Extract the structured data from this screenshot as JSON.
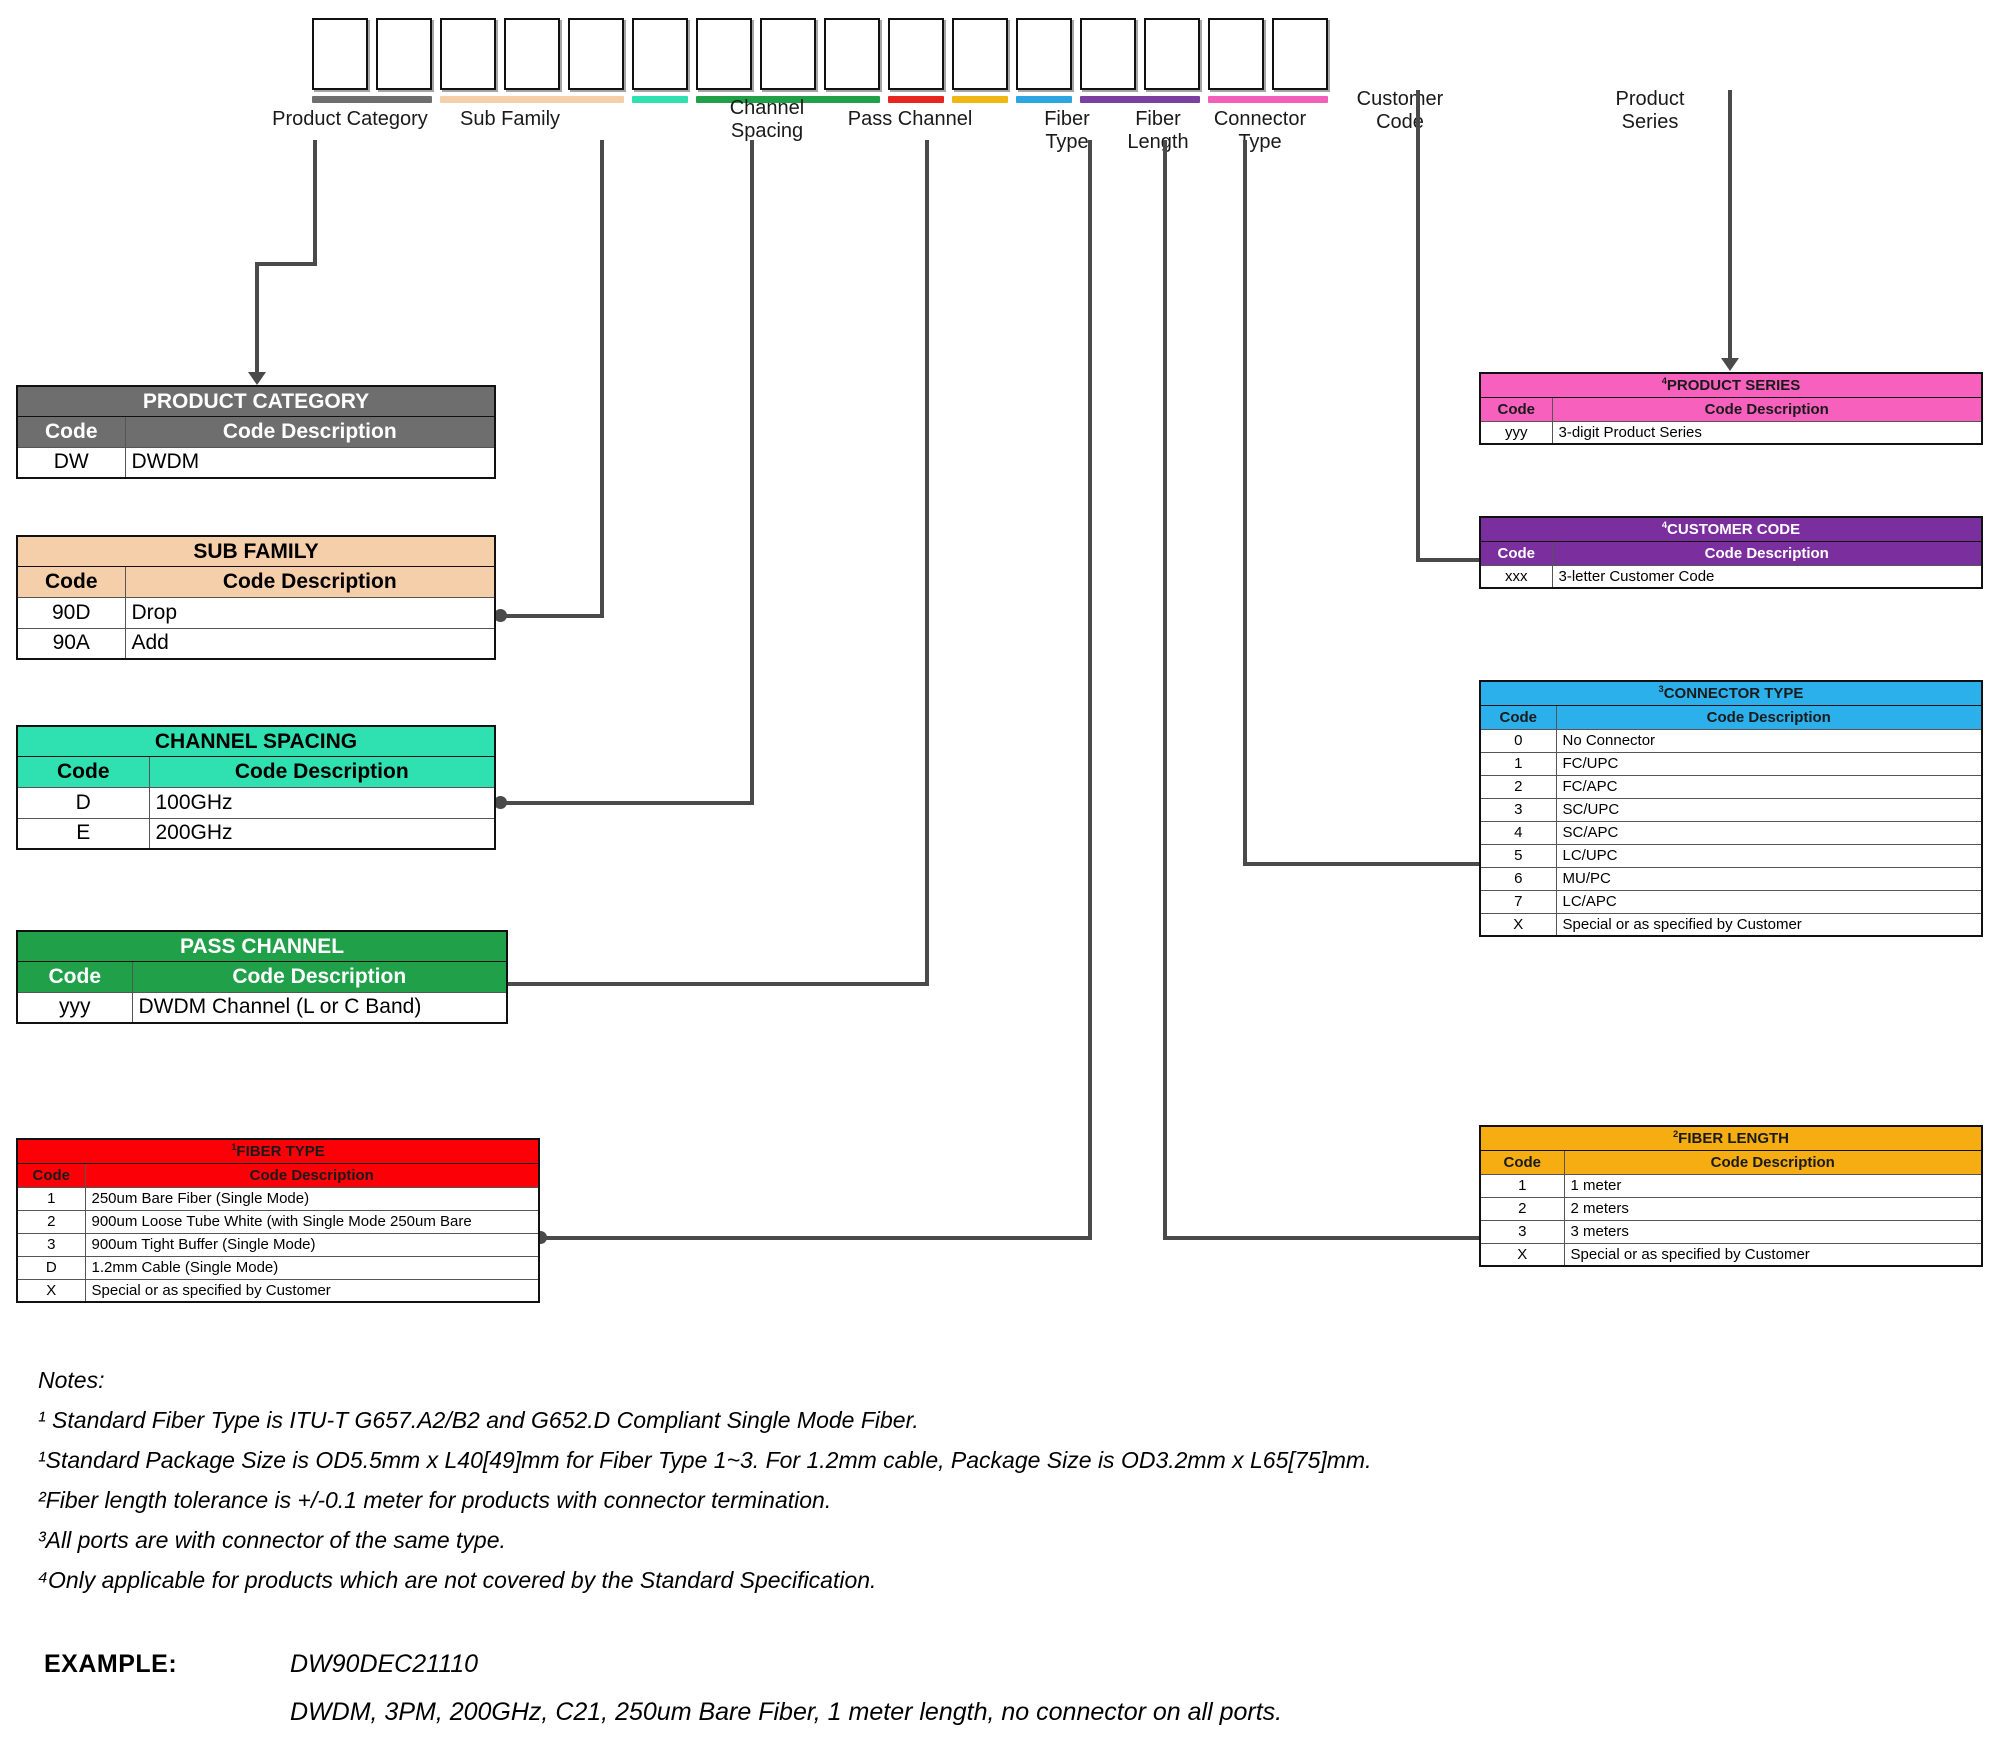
{
  "diagram": {
    "title": "DWDM Part Number Structure",
    "code_box_count": 16,
    "groups": [
      {
        "id": "product-category",
        "label": "Product Category",
        "color": "#6e6e6e",
        "boxes": 2
      },
      {
        "id": "sub-family",
        "label": "Sub Family",
        "color": "#f5ceaa",
        "boxes": 3
      },
      {
        "id": "channel-spacing",
        "label": "Channel\nSpacing",
        "color": "#2fe0b0",
        "boxes": 1
      },
      {
        "id": "pass-channel",
        "label": "Pass Channel",
        "color": "#21a04a",
        "boxes": 3
      },
      {
        "id": "fiber-type",
        "label": "Fiber\nType",
        "color": "#e8251f",
        "boxes": 1
      },
      {
        "id": "fiber-length",
        "label": "Fiber\nLength",
        "color": "#efb713",
        "boxes": 1
      },
      {
        "id": "connector-type",
        "label": "Connector\nType",
        "color": "#2ba6e0",
        "boxes": 1
      },
      {
        "id": "customer-code",
        "label": "Customer\nCode",
        "color": "#7b3fa0",
        "boxes": 2
      },
      {
        "id": "product-series",
        "label": "Product\nSeries",
        "color": "#f25fba",
        "boxes": 2
      }
    ]
  },
  "tables": {
    "product_category": {
      "title": "PRODUCT CATEGORY",
      "superscript": "",
      "header_color": "#6e6e6e",
      "title_text_color": "#ffffff",
      "header_text_color": "#ffffff",
      "columns": [
        "Code",
        "Code Description"
      ],
      "rows": [
        {
          "code": "DW",
          "desc": "DWDM"
        }
      ]
    },
    "sub_family": {
      "title": "SUB FAMILY",
      "superscript": "",
      "header_color": "#f5ceaa",
      "title_text_color": "#000000",
      "header_text_color": "#000000",
      "columns": [
        "Code",
        "Code Description"
      ],
      "rows": [
        {
          "code": "90D",
          "desc": "Drop"
        },
        {
          "code": "90A",
          "desc": "Add"
        }
      ]
    },
    "channel_spacing": {
      "title": "CHANNEL SPACING",
      "superscript": "",
      "header_color": "#2fe0b0",
      "title_text_color": "#000000",
      "header_text_color": "#000000",
      "columns": [
        "Code",
        "Code Description"
      ],
      "rows": [
        {
          "code": "D",
          "desc": "100GHz"
        },
        {
          "code": "E",
          "desc": "200GHz"
        }
      ]
    },
    "pass_channel": {
      "title": "PASS CHANNEL",
      "superscript": "",
      "header_color": "#21a04a",
      "title_text_color": "#ffffff",
      "header_text_color": "#ffffff",
      "columns": [
        "Code",
        "Code Description"
      ],
      "rows": [
        {
          "code": "yyy",
          "desc": "DWDM Channel (L or C Band)"
        }
      ]
    },
    "fiber_type": {
      "title": "FIBER TYPE",
      "superscript": "1",
      "header_color": "#fb0007",
      "title_text_color": "#1a1a1a",
      "header_text_color": "#1a1a1a",
      "columns": [
        "Code",
        "Code Description"
      ],
      "rows": [
        {
          "code": "1",
          "desc": "250um Bare Fiber (Single Mode)"
        },
        {
          "code": "2",
          "desc": "900um Loose Tube White (with Single Mode 250um Bare"
        },
        {
          "code": "3",
          "desc": "900um Tight Buffer (Single Mode)"
        },
        {
          "code": "D",
          "desc": "1.2mm Cable (Single Mode)"
        },
        {
          "code": "X",
          "desc": "Special or as specified by Customer"
        }
      ]
    },
    "fiber_length": {
      "title": "FIBER LENGTH",
      "superscript": "2",
      "header_color": "#f5ad12",
      "title_text_color": "#1a1a1a",
      "header_text_color": "#1a1a1a",
      "columns": [
        "Code",
        "Code Description"
      ],
      "rows": [
        {
          "code": "1",
          "desc": "1 meter"
        },
        {
          "code": "2",
          "desc": "2 meters"
        },
        {
          "code": "3",
          "desc": "3 meters"
        },
        {
          "code": "X",
          "desc": "Special or as specified by Customer"
        }
      ]
    },
    "connector_type": {
      "title": "CONNECTOR TYPE",
      "superscript": "3",
      "header_color": "#2bb0ec",
      "title_text_color": "#1a1a1a",
      "header_text_color": "#1a1a1a",
      "columns": [
        "Code",
        "Code Description"
      ],
      "rows": [
        {
          "code": "0",
          "desc": "No Connector"
        },
        {
          "code": "1",
          "desc": "FC/UPC"
        },
        {
          "code": "2",
          "desc": "FC/APC"
        },
        {
          "code": "3",
          "desc": "SC/UPC"
        },
        {
          "code": "4",
          "desc": "SC/APC"
        },
        {
          "code": "5",
          "desc": "LC/UPC"
        },
        {
          "code": "6",
          "desc": "MU/PC"
        },
        {
          "code": "7",
          "desc": "LC/APC"
        },
        {
          "code": "X",
          "desc": "Special or as specified by Customer"
        }
      ]
    },
    "customer_code": {
      "title": "CUSTOMER CODE",
      "superscript": "4",
      "header_color": "#7b2f9e",
      "title_text_color": "#ffffff",
      "header_text_color": "#ffffff",
      "columns": [
        "Code",
        "Code Description"
      ],
      "rows": [
        {
          "code": "xxx",
          "desc": "3-letter Customer Code"
        }
      ]
    },
    "product_series": {
      "title": "PRODUCT SERIES",
      "superscript": "4",
      "header_color": "#f860bd",
      "title_text_color": "#1a1a1a",
      "header_text_color": "#1a1a1a",
      "columns": [
        "Code",
        "Code Description"
      ],
      "rows": [
        {
          "code": "yyy",
          "desc": "3-digit Product Series"
        }
      ]
    }
  },
  "notes": {
    "heading": "Notes:",
    "items": [
      "¹ Standard Fiber Type is ITU-T G657.A2/B2 and G652.D Compliant Single Mode Fiber.",
      "¹Standard Package Size is OD5.5mm x L40[49]mm for Fiber Type 1~3. For 1.2mm cable, Package Size is OD3.2mm x L65[75]mm.",
      "²Fiber length tolerance is +/-0.1 meter for products with connector termination.",
      "³All ports are with connector of the same type.",
      "⁴Only applicable for products which are not covered by the Standard Specification."
    ]
  },
  "example": {
    "label": "EXAMPLE:",
    "part_number": "DW90DEC21110",
    "description": "DWDM, 3PM, 200GHz, C21, 250um Bare Fiber, 1 meter length, no connector on all ports."
  }
}
